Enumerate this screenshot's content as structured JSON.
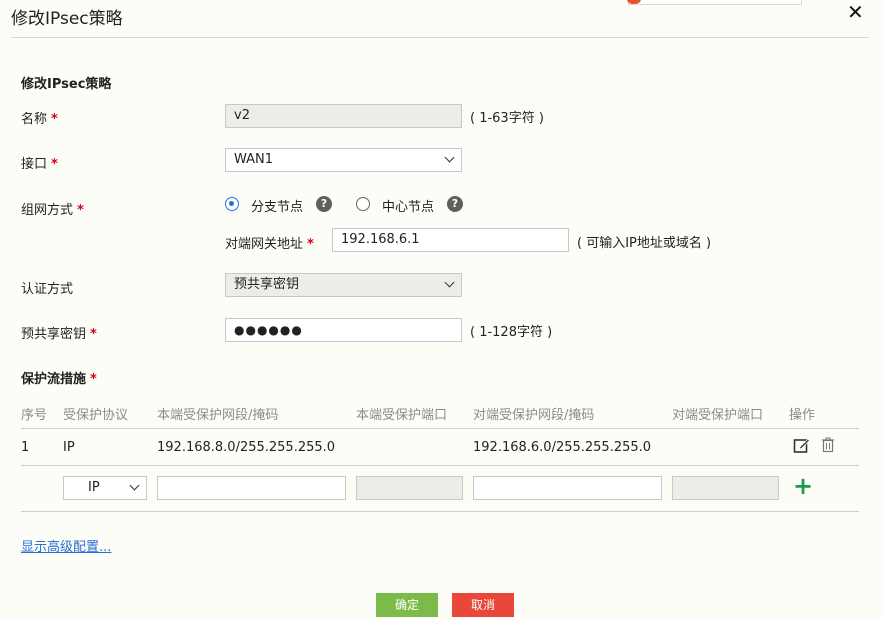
{
  "dialog": {
    "title": "修改IPsec策略",
    "close_symbol": "✕"
  },
  "form": {
    "section_title": "修改IPsec策略",
    "required_mark": "*",
    "name": {
      "label": "名称",
      "value": "v2",
      "hint": "( 1-63字符 )"
    },
    "interface": {
      "label": "接口",
      "value": "WAN1"
    },
    "network_mode": {
      "label": "组网方式",
      "options": [
        {
          "label": "分支节点",
          "selected": true
        },
        {
          "label": "中心节点",
          "selected": false
        }
      ],
      "help_symbol": "?"
    },
    "peer_gateway": {
      "label": "对端网关地址",
      "value": "192.168.6.1",
      "hint": "( 可输入IP地址或域名 )"
    },
    "auth_method": {
      "label": "认证方式",
      "value": "预共享密钥"
    },
    "psk": {
      "label": "预共享密钥",
      "value": "●●●●●●",
      "hint": "( 1-128字符 )"
    }
  },
  "protection": {
    "section_title": "保护流措施",
    "columns": [
      "序号",
      "受保护协议",
      "本端受保护网段/掩码",
      "本端受保护端口",
      "对端受保护网段/掩码",
      "对端受保护端口",
      "操作"
    ],
    "rows": [
      {
        "index": "1",
        "protocol": "IP",
        "local_net": "192.168.8.0/255.255.255.0",
        "local_port": "",
        "peer_net": "192.168.6.0/255.255.255.0",
        "peer_port": ""
      }
    ],
    "new_row": {
      "protocol": "IP",
      "add_symbol": "+"
    }
  },
  "advanced_link": "显示高级配置...",
  "buttons": {
    "ok": "确定",
    "cancel": "取消"
  },
  "colors": {
    "ok": "#7cbb4a",
    "cancel": "#e8473a",
    "link": "#2a6fd6",
    "required": "#d0021b",
    "add": "#1e9a49"
  },
  "icons": {
    "edit": "edit-icon",
    "delete": "trash-icon",
    "help": "help-circle-icon",
    "close": "close-icon"
  }
}
